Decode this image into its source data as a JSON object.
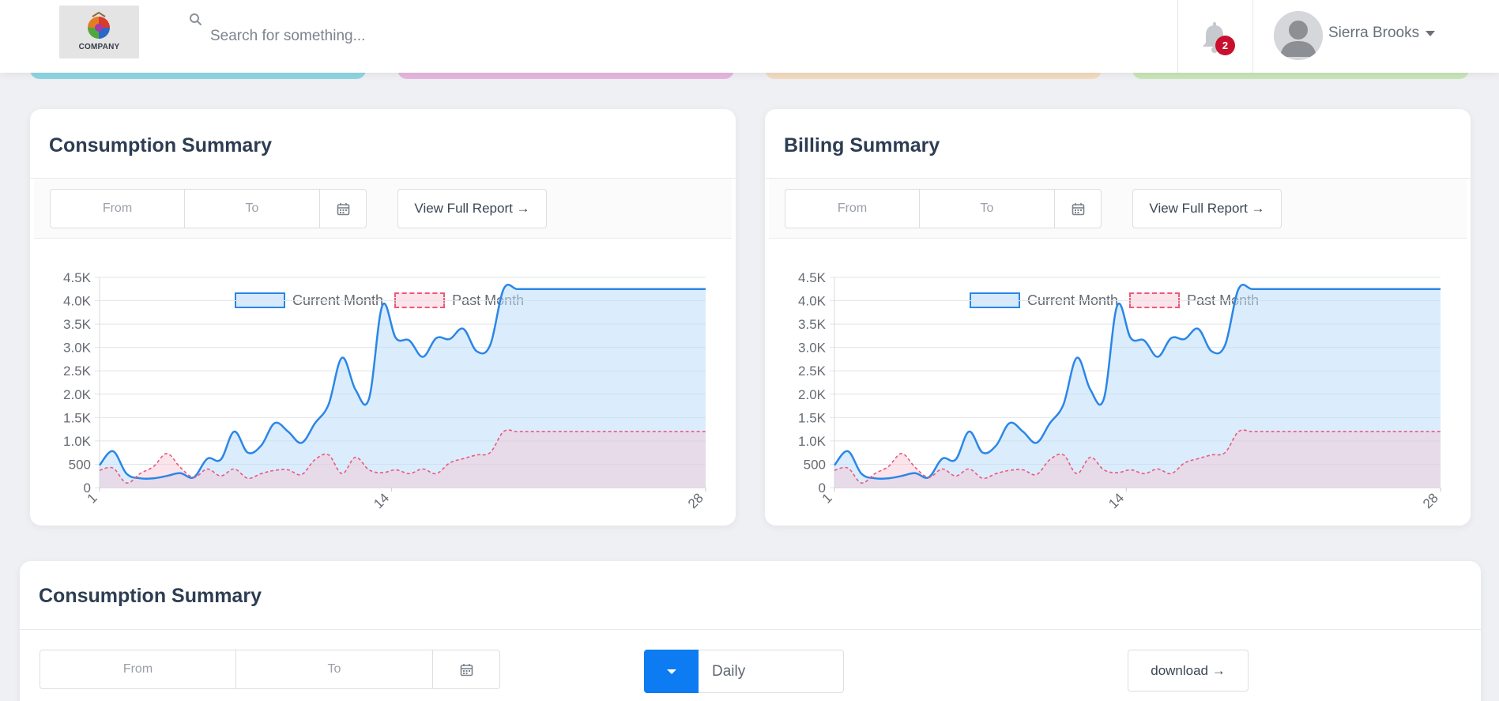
{
  "app": {
    "logo_text": "COMPANY",
    "search_placeholder": "Search for something...",
    "notifications_count": "2",
    "user_name": "Sierra Brooks"
  },
  "colors": {
    "accent": "#0d7cf2",
    "current_line": "#2b86e8",
    "current_fill": "#d6eafd",
    "past_line": "#ea5a7c",
    "past_fill": "#fde4ea",
    "badge": "#c8102e",
    "stat_cards": [
      "#8fd6e2",
      "#e7b8df",
      "#f3dcc0",
      "#c8e6b8"
    ]
  },
  "consumption_card": {
    "title": "Consumption Summary",
    "from_placeholder": "From",
    "to_placeholder": "To",
    "report_button": "View Full Report →"
  },
  "billing_card": {
    "title": "Billing Summary",
    "from_placeholder": "From",
    "to_placeholder": "To",
    "report_button": "View Full Report →"
  },
  "bottom_card": {
    "title": "Consumption Summary",
    "from_placeholder": "From",
    "to_placeholder": "To",
    "period_value": "Daily",
    "download_button": "download →"
  },
  "chart_data": [
    {
      "type": "area",
      "y_tick_labels": [
        "0",
        "500",
        "1.0K",
        "1.5K",
        "2.0K",
        "2.5K",
        "3.0K",
        "3.5K",
        "4.0K",
        "4.5K"
      ],
      "ylim": [
        0,
        4500
      ],
      "xlim": [
        1,
        28
      ],
      "x_tick_labels": [
        {
          "x": 1,
          "label": "1"
        },
        {
          "x": 14,
          "label": "14"
        },
        {
          "x": 28,
          "label": "28"
        }
      ],
      "grid": true,
      "legend_position": "top-center",
      "x": [
        1,
        1.6,
        2.2,
        2.8,
        3.4,
        4,
        4.6,
        5.2,
        5.8,
        6.4,
        7,
        7.6,
        8.2,
        8.8,
        9.4,
        10,
        10.6,
        11.2,
        11.8,
        12.4,
        13,
        13.6,
        14.2,
        14.8,
        15.4,
        16,
        16.6,
        17.2,
        17.8,
        18.4,
        19,
        19.6,
        20.2,
        20.8,
        21.4,
        22,
        22.6,
        23.2,
        23.8,
        24.4,
        25,
        25.6,
        26.2,
        26.8,
        27.4,
        28
      ],
      "series": [
        {
          "name": "Current Month",
          "values": [
            480,
            780,
            300,
            200,
            200,
            250,
            310,
            220,
            620,
            600,
            1200,
            750,
            900,
            1380,
            1200,
            960,
            1380,
            1780,
            2780,
            2100,
            1900,
            3900,
            3200,
            3150,
            2800,
            3200,
            3180,
            3400,
            2920,
            3050,
            4250,
            4250,
            4250,
            4250,
            4250,
            4250,
            4250,
            4250,
            4250,
            4250,
            4250,
            4250,
            4250,
            4250,
            4250,
            4250
          ]
        },
        {
          "name": "Past Month",
          "values": [
            370,
            420,
            100,
            300,
            450,
            730,
            430,
            220,
            400,
            250,
            400,
            200,
            300,
            370,
            380,
            280,
            600,
            700,
            300,
            650,
            380,
            320,
            380,
            300,
            400,
            300,
            530,
            620,
            700,
            750,
            1200,
            1200,
            1200,
            1200,
            1200,
            1200,
            1200,
            1200,
            1200,
            1200,
            1200,
            1200,
            1200,
            1200,
            1200,
            1200
          ]
        }
      ]
    },
    {
      "type": "area",
      "y_tick_labels": [
        "0",
        "500",
        "1.0K",
        "1.5K",
        "2.0K",
        "2.5K",
        "3.0K",
        "3.5K",
        "4.0K",
        "4.5K"
      ],
      "ylim": [
        0,
        4500
      ],
      "xlim": [
        1,
        28
      ],
      "x_tick_labels": [
        {
          "x": 1,
          "label": "1"
        },
        {
          "x": 14,
          "label": "14"
        },
        {
          "x": 28,
          "label": "28"
        }
      ],
      "grid": true,
      "legend_position": "top-center",
      "x": [
        1,
        1.6,
        2.2,
        2.8,
        3.4,
        4,
        4.6,
        5.2,
        5.8,
        6.4,
        7,
        7.6,
        8.2,
        8.8,
        9.4,
        10,
        10.6,
        11.2,
        11.8,
        12.4,
        13,
        13.6,
        14.2,
        14.8,
        15.4,
        16,
        16.6,
        17.2,
        17.8,
        18.4,
        19,
        19.6,
        20.2,
        20.8,
        21.4,
        22,
        22.6,
        23.2,
        23.8,
        24.4,
        25,
        25.6,
        26.2,
        26.8,
        27.4,
        28
      ],
      "series": [
        {
          "name": "Current Month",
          "values": [
            480,
            780,
            300,
            200,
            200,
            250,
            310,
            220,
            620,
            600,
            1200,
            750,
            900,
            1380,
            1200,
            960,
            1380,
            1780,
            2780,
            2100,
            1900,
            3900,
            3200,
            3150,
            2800,
            3200,
            3180,
            3400,
            2920,
            3050,
            4250,
            4250,
            4250,
            4250,
            4250,
            4250,
            4250,
            4250,
            4250,
            4250,
            4250,
            4250,
            4250,
            4250,
            4250,
            4250
          ]
        },
        {
          "name": "Past Month",
          "values": [
            370,
            420,
            100,
            300,
            450,
            730,
            430,
            220,
            400,
            250,
            400,
            200,
            300,
            370,
            380,
            280,
            600,
            700,
            300,
            650,
            380,
            320,
            380,
            300,
            400,
            300,
            530,
            620,
            700,
            750,
            1200,
            1200,
            1200,
            1200,
            1200,
            1200,
            1200,
            1200,
            1200,
            1200,
            1200,
            1200,
            1200,
            1200,
            1200,
            1200
          ]
        }
      ]
    }
  ]
}
